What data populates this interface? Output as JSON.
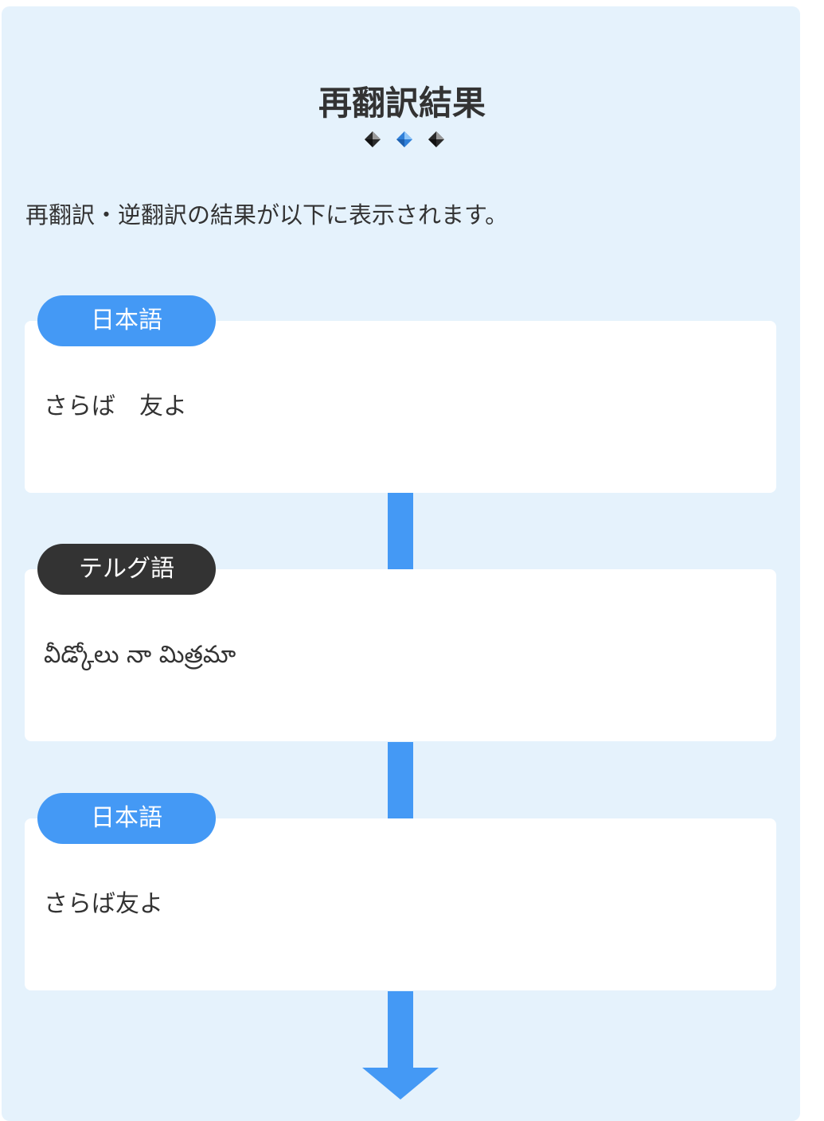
{
  "header": {
    "title": "再翻訳結果"
  },
  "intro": "再翻訳・逆翻訳の結果が以下に表示されます。",
  "colors": {
    "accent": "#4499f5",
    "dark_label": "#333333",
    "panel_background": "#e5f2fc"
  },
  "results": [
    {
      "language": "日本語",
      "text": "さらば　友よ"
    },
    {
      "language": "テルグ語",
      "text": "వీడ్కోలు నా మిత్రమా"
    },
    {
      "language": "日本語",
      "text": "さらば友よ"
    }
  ]
}
